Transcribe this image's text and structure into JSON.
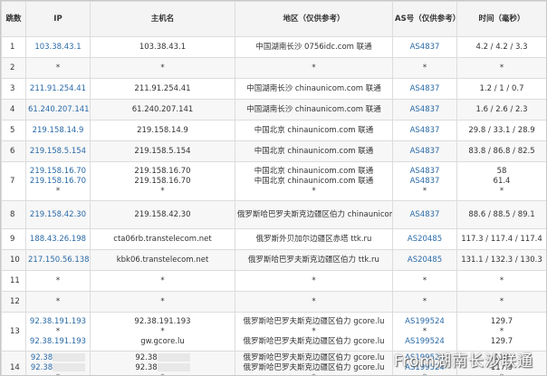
{
  "headers": {
    "hop": "跳数",
    "ip": "IP",
    "host": "主机名",
    "region": "地区（仅供参考）",
    "as": "AS号（仅供参考）",
    "time": "时间（毫秒）"
  },
  "rows": [
    {
      "hop": "1",
      "ip": [
        "103.38.43.1"
      ],
      "host": [
        "103.38.43.1"
      ],
      "region": [
        "中国湖南长沙 0756idc.com 联通"
      ],
      "as": [
        "AS4837"
      ],
      "time": [
        "4.2 / 4.2 / 3.3"
      ]
    },
    {
      "hop": "2",
      "ip": [
        "*"
      ],
      "host": [
        "*"
      ],
      "region": [
        "*"
      ],
      "as": [
        "*"
      ],
      "time": [
        "*"
      ]
    },
    {
      "hop": "3",
      "ip": [
        "211.91.254.41"
      ],
      "host": [
        "211.91.254.41"
      ],
      "region": [
        "中国湖南长沙 chinaunicom.com 联通"
      ],
      "as": [
        "AS4837"
      ],
      "time": [
        "1.2 / 1 / 0.7"
      ]
    },
    {
      "hop": "4",
      "ip": [
        "61.240.207.141"
      ],
      "host": [
        "61.240.207.141"
      ],
      "region": [
        "中国湖南长沙 chinaunicom.com 联通"
      ],
      "as": [
        "AS4837"
      ],
      "time": [
        "1.6 / 2.6 / 2.3"
      ]
    },
    {
      "hop": "5",
      "ip": [
        "219.158.14.9"
      ],
      "host": [
        "219.158.14.9"
      ],
      "region": [
        "中国北京 chinaunicom.com 联通"
      ],
      "as": [
        "AS4837"
      ],
      "time": [
        "29.8 / 33.1 / 28.9"
      ]
    },
    {
      "hop": "6",
      "ip": [
        "219.158.5.154"
      ],
      "host": [
        "219.158.5.154"
      ],
      "region": [
        "中国北京 chinaunicom.com 联通"
      ],
      "as": [
        "AS4837"
      ],
      "time": [
        "83.8 / 86.8 / 82.5"
      ]
    },
    {
      "hop": "7",
      "ip": [
        "219.158.16.70",
        "219.158.16.70",
        "*"
      ],
      "host": [
        "219.158.16.70",
        "219.158.16.70",
        "*"
      ],
      "region": [
        "中国北京 chinaunicom.com 联通",
        "中国北京 chinaunicom.com 联通",
        "*"
      ],
      "as": [
        "AS4837",
        "AS4837",
        "*"
      ],
      "time": [
        "58",
        "61.4",
        "*"
      ]
    },
    {
      "hop": "8",
      "ip": [
        "219.158.42.30"
      ],
      "host": [
        "219.158.42.30"
      ],
      "region": [
        "俄罗斯哈巴罗夫斯克边疆区伯力 chinaunicom.com 联通"
      ],
      "as": [
        "AS4837"
      ],
      "time": [
        "88.6 / 88.5 / 89.1"
      ]
    },
    {
      "hop": "9",
      "ip": [
        "188.43.26.198"
      ],
      "host": [
        "cta06rb.transtelecom.net"
      ],
      "region": [
        "俄罗斯外贝加尔边疆区赤塔 ttk.ru"
      ],
      "as": [
        "AS20485"
      ],
      "time": [
        "117.3 / 117.4 / 117.4"
      ]
    },
    {
      "hop": "10",
      "ip": [
        "217.150.56.138"
      ],
      "host": [
        "kbk06.transtelecom.net"
      ],
      "region": [
        "俄罗斯哈巴罗夫斯克边疆区伯力 ttk.ru"
      ],
      "as": [
        "AS20485"
      ],
      "time": [
        "131.1 / 132.3 / 130.3"
      ]
    },
    {
      "hop": "11",
      "ip": [
        "*"
      ],
      "host": [
        "*"
      ],
      "region": [
        "*"
      ],
      "as": [
        "*"
      ],
      "time": [
        "*"
      ]
    },
    {
      "hop": "12",
      "ip": [
        "*"
      ],
      "host": [
        "*"
      ],
      "region": [
        "*"
      ],
      "as": [
        "*"
      ],
      "time": [
        "*"
      ]
    },
    {
      "hop": "13",
      "ip": [
        "92.38.191.193",
        "*",
        "92.38.191.193"
      ],
      "host": [
        "92.38.191.193",
        "*",
        "gw.gcore.lu"
      ],
      "region": [
        "俄罗斯哈巴罗夫斯克边疆区伯力 gcore.lu",
        "*",
        "俄罗斯哈巴罗夫斯克边疆区伯力 gcore.lu"
      ],
      "as": [
        "AS199524",
        "*",
        "AS199524"
      ],
      "time": [
        "129.7",
        "*",
        "129.7"
      ]
    },
    {
      "hop": "14",
      "ip": [
        "92.38",
        "92.38",
        "*"
      ],
      "host": [
        "92.38",
        "92.38",
        "*"
      ],
      "region": [
        "俄罗斯哈巴罗夫斯克边疆区伯力 gcore.lu",
        "俄罗斯哈巴罗夫斯克边疆区伯力 gcore.lu",
        "*"
      ],
      "as": [
        "AS199524",
        "AS199524",
        "*"
      ],
      "time": [
        "118",
        "117.9",
        "*"
      ]
    }
  ],
  "watermark": "From湖南长沙联通"
}
